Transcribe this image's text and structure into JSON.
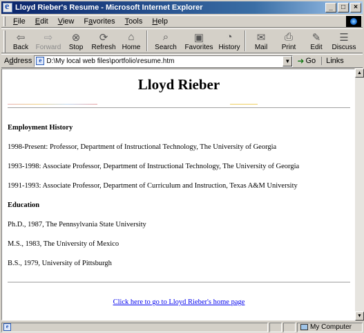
{
  "window": {
    "title": "Lloyd Rieber's Resume - Microsoft Internet Explorer"
  },
  "menubar": {
    "items": [
      {
        "pre": "",
        "u": "F",
        "post": "ile"
      },
      {
        "pre": "",
        "u": "E",
        "post": "dit"
      },
      {
        "pre": "",
        "u": "V",
        "post": "iew"
      },
      {
        "pre": "F",
        "u": "a",
        "post": "vorites"
      },
      {
        "pre": "",
        "u": "T",
        "post": "ools"
      },
      {
        "pre": "",
        "u": "H",
        "post": "elp"
      }
    ]
  },
  "toolbar": {
    "back": "Back",
    "forward": "Forward",
    "stop": "Stop",
    "refresh": "Refresh",
    "home": "Home",
    "search": "Search",
    "favorites": "Favorites",
    "history": "History",
    "mail": "Mail",
    "print": "Print",
    "edit": "Edit",
    "discuss": "Discuss"
  },
  "address": {
    "label_pre": "A",
    "label_u": "d",
    "label_post": "dress",
    "value": "D:\\My local web files\\portfolio\\resume.htm",
    "go": "Go",
    "links": "Links"
  },
  "page": {
    "heading": "Lloyd Rieber",
    "employment_title": "Employment History",
    "employment": [
      "1998-Present: Professor, Department of Instructional Technology, The University of Georgia",
      "1993-1998: Associate Professor, Department of Instructional Technology, The University of Georgia",
      "1991-1993: Associate Professor, Department of Curriculum and Instruction, Texas A&M University"
    ],
    "education_title": "Education",
    "education": [
      "Ph.D., 1987, The Pennsylvania State University",
      "M.S., 1983, The University of Mexico",
      "B.S., 1979, University of Pittsburgh"
    ],
    "home_link": "Click here to go to Lloyd Rieber's home page"
  },
  "status": {
    "zone": "My Computer"
  }
}
